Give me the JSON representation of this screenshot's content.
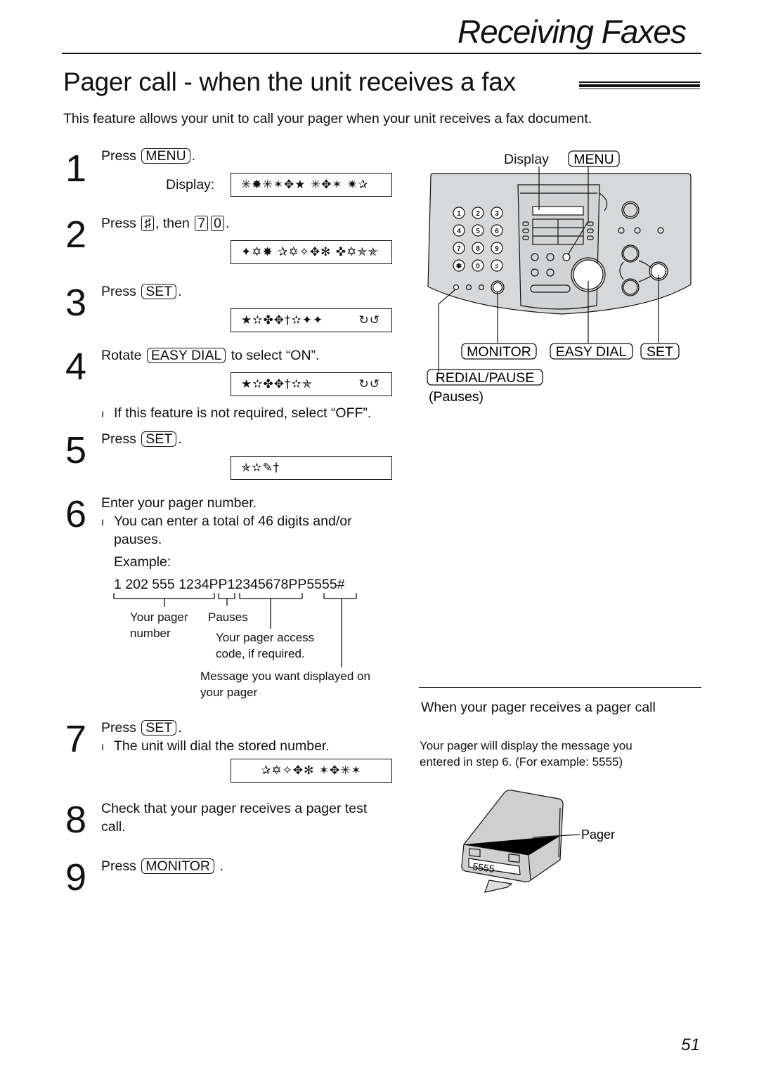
{
  "header": {
    "section_title": "Receiving Faxes",
    "page_title": "Pager call - when the unit receives a fax",
    "intro": "This feature allows your unit to call your pager when your unit receives a fax document."
  },
  "steps": [
    {
      "number": "1",
      "prefix": "Press",
      "key": "MENU",
      "suffix": ".",
      "display_label": "Display:",
      "lcd": "✳✸✳✶✥★ ✳✥✶ ✷✰"
    },
    {
      "number": "2",
      "prefix": "Press",
      "key": "♯",
      "middle": ", then",
      "keys": [
        "7",
        "0"
      ],
      "suffix": ".",
      "lcd": "✦✡✸ ✰✡✧✥✻ ✜✡✯✯"
    },
    {
      "number": "3",
      "prefix": "Press",
      "key": "SET",
      "suffix": ".",
      "lcd": "★✫✤✥†✫✦✦",
      "lcd_right": "↻↺"
    },
    {
      "number": "4",
      "prefix": "Rotate",
      "key": "EASY DIAL",
      "suffix": "to select “ON”.",
      "lcd": "★✫✤✥†✫✯",
      "lcd_right": "↻↺",
      "note": "If this feature is not required, select “OFF”."
    },
    {
      "number": "5",
      "prefix": "Press",
      "key": "SET",
      "suffix": ".",
      "lcd": "✯✫✎†"
    },
    {
      "number": "6",
      "text": "Enter your pager number.",
      "note": "You can enter a total of 46 digits and/or",
      "note_cont": "pauses.",
      "example_label": "Example:",
      "example": "1 202 555 1234PP12345678PP5555#",
      "callouts": {
        "pager_number": [
          "Your pager",
          "number"
        ],
        "pauses": "Pauses",
        "access_code": [
          "Your pager access",
          "code, if required."
        ],
        "message": [
          "Message you want displayed on",
          "your pager"
        ]
      }
    },
    {
      "number": "7",
      "prefix": "Press",
      "key": "SET",
      "suffix": ".",
      "note": "The unit will dial the stored number.",
      "lcd": "✰✡✧✥✻ ✶✥✳✶"
    },
    {
      "number": "8",
      "text": "Check that your pager receives a pager test",
      "text_cont": "call."
    },
    {
      "number": "9",
      "prefix": "Press",
      "key": "MONITOR",
      "suffix": "."
    }
  ],
  "fax_diagram": {
    "labels": {
      "display": "Display",
      "menu": "MENU",
      "monitor": "MONITOR",
      "easy_dial": "EASY DIAL",
      "set": "SET",
      "redial_pause": "REDIAL/PAUSE",
      "pauses_note": "(Pauses)"
    },
    "keypad": [
      "1",
      "2",
      "3",
      "4",
      "5",
      "6",
      "7",
      "8",
      "9",
      "✱",
      "0",
      "♯"
    ],
    "panel_color": "#d7d8d9"
  },
  "pager_section": {
    "heading": "When your pager receives a pager call",
    "body_line1": "Your pager will display the message you",
    "body_line2": "entered in step 6. (For example: 5555)",
    "pager_label": "Pager",
    "pager_display": "5555",
    "pager_color": "#cfcfcf"
  },
  "footer": {
    "page_number": "51"
  }
}
